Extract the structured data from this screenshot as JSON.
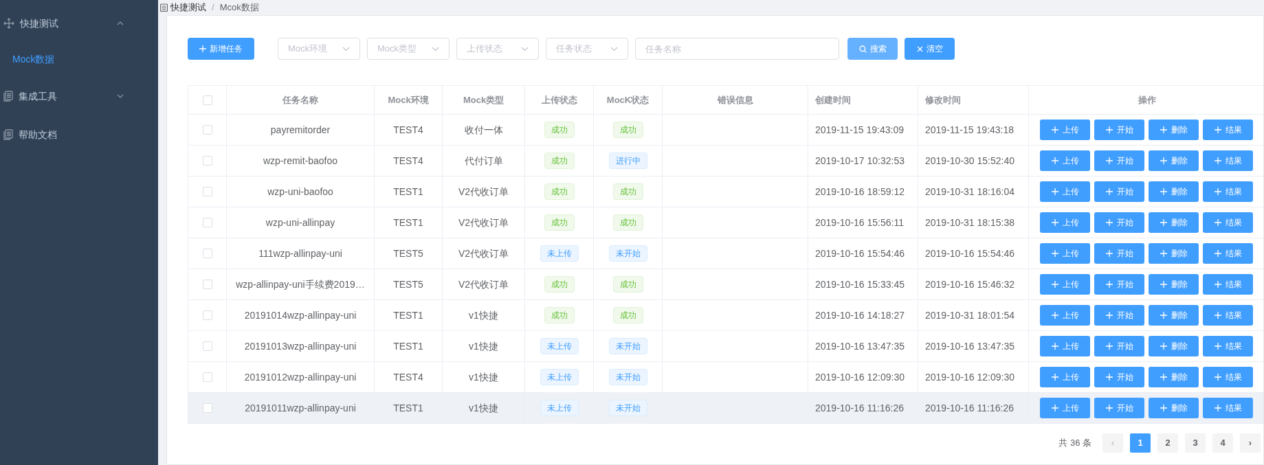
{
  "sidebar": {
    "items": [
      {
        "label": "快捷测试",
        "kind": "move",
        "expanded": true,
        "children": [
          {
            "label": "Mock数据",
            "selected": true
          }
        ]
      },
      {
        "label": "集成工具",
        "kind": "doc",
        "expanded": false
      },
      {
        "label": "帮助文档",
        "kind": "doc"
      }
    ]
  },
  "breadcrumb": {
    "items": [
      "快捷测试",
      "Mcok数据"
    ],
    "separator": "/"
  },
  "toolbar": {
    "add_button": "新增任务",
    "filters": [
      {
        "placeholder": "Mock环境"
      },
      {
        "placeholder": "Mock类型"
      },
      {
        "placeholder": "上传状态"
      },
      {
        "placeholder": "任务状态"
      }
    ],
    "search_field": {
      "placeholder": "任务名称"
    },
    "search_button": "搜索",
    "clear_button": "清空"
  },
  "table": {
    "all_checked": false,
    "columns": [
      "任务名称",
      "Mock环境",
      "Mock类型",
      "上传状态",
      "MocK状态",
      "错误信息",
      "创建时间",
      "修改时间",
      "操作"
    ],
    "rows": [
      {
        "checked": false,
        "highlighted": false,
        "name": "payremitorder",
        "env": "TEST4",
        "type": "收付一体",
        "upload": {
          "text": "成功",
          "kind": "success"
        },
        "mock": {
          "text": "成功",
          "kind": "success"
        },
        "created": "2019-11-15 19:43:09",
        "modified": "2019-11-15 19:43:18",
        "actions": [
          "上传",
          "开始",
          "删除",
          "结果"
        ]
      },
      {
        "checked": false,
        "highlighted": false,
        "name": "wzp-remit-baofoo",
        "env": "TEST4",
        "type": "代付订单",
        "upload": {
          "text": "成功",
          "kind": "success"
        },
        "mock": {
          "text": "进行中",
          "kind": "info"
        },
        "created": "2019-10-17 10:32:53",
        "modified": "2019-10-30 15:52:40",
        "actions": [
          "上传",
          "开始",
          "删除",
          "结果"
        ]
      },
      {
        "checked": false,
        "highlighted": false,
        "name": "wzp-uni-baofoo",
        "env": "TEST1",
        "type": "V2代收订单",
        "upload": {
          "text": "成功",
          "kind": "success"
        },
        "mock": {
          "text": "成功",
          "kind": "success"
        },
        "created": "2019-10-16 18:59:12",
        "modified": "2019-10-31 18:16:04",
        "actions": [
          "上传",
          "开始",
          "删除",
          "结果"
        ]
      },
      {
        "checked": false,
        "highlighted": false,
        "name": "wzp-uni-allinpay",
        "env": "TEST1",
        "type": "V2代收订单",
        "upload": {
          "text": "成功",
          "kind": "success"
        },
        "mock": {
          "text": "成功",
          "kind": "success"
        },
        "created": "2019-10-16 15:56:11",
        "modified": "2019-10-31 18:15:38",
        "actions": [
          "上传",
          "开始",
          "删除",
          "结果"
        ]
      },
      {
        "checked": false,
        "highlighted": false,
        "name": "111wzp-allinpay-uni",
        "env": "TEST5",
        "type": "V2代收订单",
        "upload": {
          "text": "未上传",
          "kind": "info"
        },
        "mock": {
          "text": "未开始",
          "kind": "info"
        },
        "created": "2019-10-16 15:54:46",
        "modified": "2019-10-16 15:54:46",
        "actions": [
          "上传",
          "开始",
          "删除",
          "结果"
        ]
      },
      {
        "checked": false,
        "highlighted": false,
        "name": "wzp-allinpay-uni手续费2019…",
        "env": "TEST5",
        "type": "V2代收订单",
        "upload": {
          "text": "成功",
          "kind": "success"
        },
        "mock": {
          "text": "成功",
          "kind": "success"
        },
        "created": "2019-10-16 15:33:45",
        "modified": "2019-10-16 15:46:32",
        "actions": [
          "上传",
          "开始",
          "删除",
          "结果"
        ]
      },
      {
        "checked": false,
        "highlighted": false,
        "name": "20191014wzp-allinpay-uni",
        "env": "TEST1",
        "type": "v1快捷",
        "upload": {
          "text": "成功",
          "kind": "success"
        },
        "mock": {
          "text": "成功",
          "kind": "success"
        },
        "created": "2019-10-16 14:18:27",
        "modified": "2019-10-31 18:01:54",
        "actions": [
          "上传",
          "开始",
          "删除",
          "结果"
        ]
      },
      {
        "checked": false,
        "highlighted": false,
        "name": "20191013wzp-allinpay-uni",
        "env": "TEST1",
        "type": "v1快捷",
        "upload": {
          "text": "未上传",
          "kind": "info"
        },
        "mock": {
          "text": "未开始",
          "kind": "info"
        },
        "created": "2019-10-16 13:47:35",
        "modified": "2019-10-16 13:47:35",
        "actions": [
          "上传",
          "开始",
          "删除",
          "结果"
        ]
      },
      {
        "checked": false,
        "highlighted": false,
        "name": "20191012wzp-allinpay-uni",
        "env": "TEST4",
        "type": "v1快捷",
        "upload": {
          "text": "未上传",
          "kind": "info"
        },
        "mock": {
          "text": "未开始",
          "kind": "info"
        },
        "created": "2019-10-16 12:09:30",
        "modified": "2019-10-16 12:09:30",
        "actions": [
          "上传",
          "开始",
          "删除",
          "结果"
        ]
      },
      {
        "checked": false,
        "highlighted": true,
        "name": "20191011wzp-allinpay-uni",
        "env": "TEST1",
        "type": "v1快捷",
        "upload": {
          "text": "未上传",
          "kind": "info"
        },
        "mock": {
          "text": "未开始",
          "kind": "info"
        },
        "created": "2019-10-16 11:16:26",
        "modified": "2019-10-16 11:16:26",
        "actions": [
          "上传",
          "开始",
          "删除",
          "结果"
        ]
      }
    ]
  },
  "pagination": {
    "total": "共 36 条",
    "prev": {
      "label": "‹",
      "disabled": true
    },
    "pages": [
      {
        "label": "1",
        "selected": true
      },
      {
        "label": "2",
        "selected": false
      },
      {
        "label": "3",
        "selected": false
      },
      {
        "label": "4",
        "selected": false
      }
    ],
    "next": {
      "label": "›",
      "disabled": false
    }
  }
}
